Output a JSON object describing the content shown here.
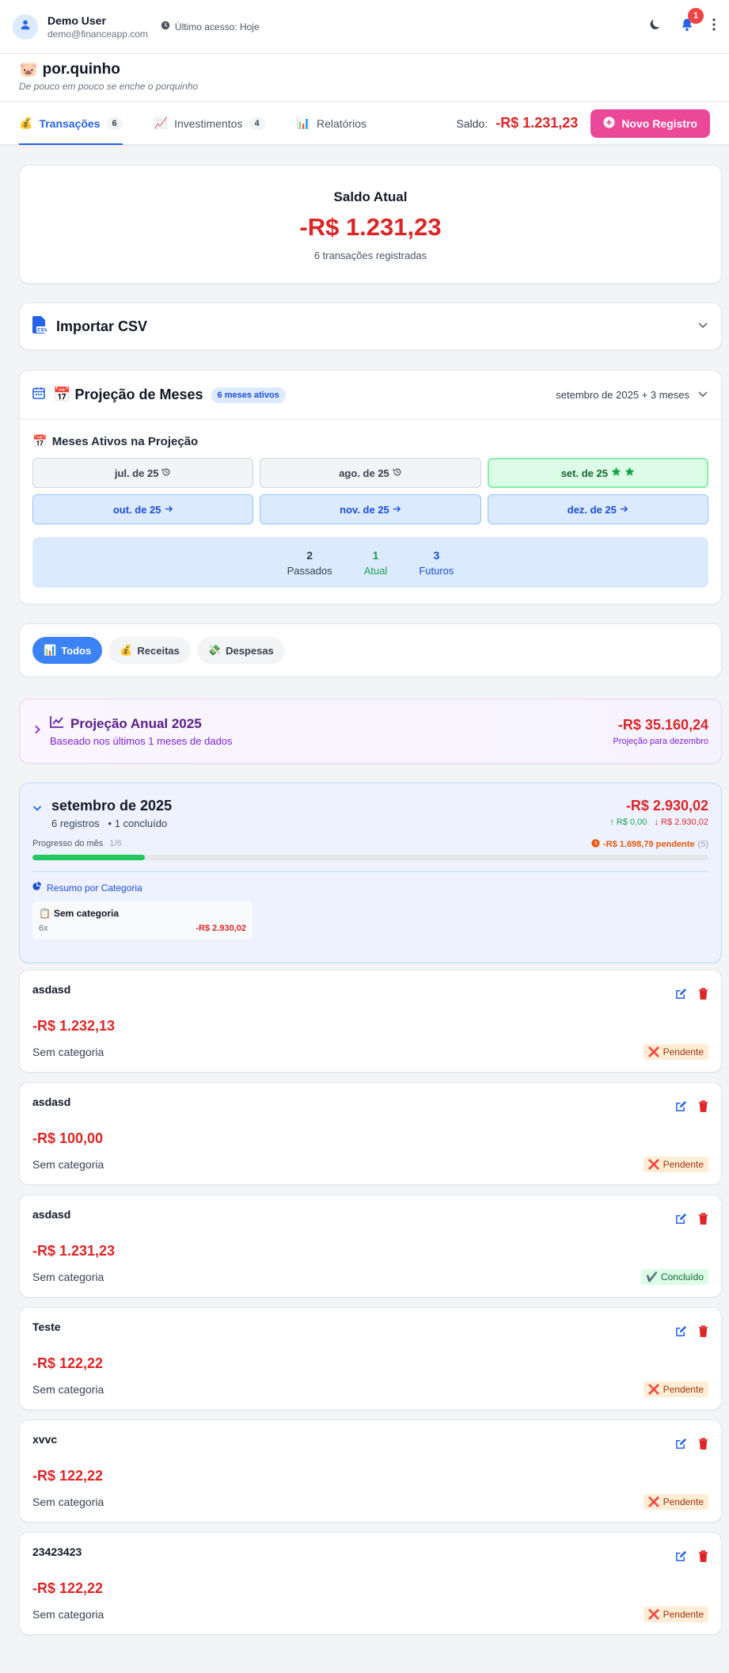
{
  "header": {
    "user_name": "Demo User",
    "user_email": "demo@financeapp.com",
    "last_access": "Último acesso: Hoje",
    "notification_count": "1"
  },
  "brand": {
    "emoji": "🐷",
    "title": "por.quinho",
    "subtitle": "De pouco em pouco se enche o porquinho"
  },
  "tabs": [
    {
      "icon": "💰",
      "label": "Transações",
      "count": "6"
    },
    {
      "icon": "📈",
      "label": "Investimentos",
      "count": "4"
    },
    {
      "icon": "📊",
      "label": "Relatórios",
      "count": ""
    }
  ],
  "toolbar": {
    "saldo_label": "Saldo:",
    "saldo_value": "-R$ 1.231,23",
    "new_button": "Novo Registro"
  },
  "balance": {
    "title": "Saldo Atual",
    "value": "-R$ 1.231,23",
    "subtitle": "6 transações registradas"
  },
  "csv": {
    "label": "Importar CSV"
  },
  "projection": {
    "emoji": "📅",
    "title": "Projeção de Meses",
    "badge": "6 meses ativos",
    "range": "setembro de 2025 + 3 meses",
    "subtitle_emoji": "📅",
    "subtitle": "Meses Ativos na Projeção",
    "months": [
      {
        "label": "jul. de 25",
        "state": "past"
      },
      {
        "label": "ago. de 25",
        "state": "past"
      },
      {
        "label": "set. de 25",
        "state": "current"
      },
      {
        "label": "out. de 25",
        "state": "future"
      },
      {
        "label": "nov. de 25",
        "state": "future"
      },
      {
        "label": "dez. de 25",
        "state": "future"
      }
    ],
    "stats": [
      {
        "n": "2",
        "label": "Passados",
        "color": "#374151"
      },
      {
        "n": "1",
        "label": "Atual",
        "color": "#16a34a"
      },
      {
        "n": "3",
        "label": "Futuros",
        "color": "#1d4ed8"
      }
    ]
  },
  "filters": [
    {
      "icon": "📊",
      "label": "Todos",
      "active": true
    },
    {
      "icon": "💰",
      "label": "Receitas",
      "active": false
    },
    {
      "icon": "💸",
      "label": "Despesas",
      "active": false
    }
  ],
  "annual": {
    "title": "Projeção Anual 2025",
    "subtitle": "Baseado nos últimos 1 meses de dados",
    "value": "-R$ 35.160,24",
    "note": "Projeção para dezembro"
  },
  "month_summary": {
    "title": "setembro de 2025",
    "records": "6 registros",
    "completed": "• 1 concluído",
    "total": "-R$ 2.930,02",
    "income": "↑ R$ 0,00",
    "expense": "↓ R$ 2.930,02",
    "progress_label": "Progresso do mês",
    "progress_count": "1/6",
    "progress_fraction": 0.1667,
    "pending_text": "-R$ 1.698,79 pendente",
    "pending_count": "(5)",
    "category_heading": "Resumo por Categoria",
    "category": {
      "emoji": "📋",
      "name": "Sem categoria",
      "count": "6x",
      "value": "-R$ 2.930,02"
    }
  },
  "transactions": [
    {
      "name": "asdasd",
      "amount": "-R$ 1.232,13",
      "category": "Sem categoria",
      "status": "Pendente",
      "status_icon": "❌",
      "status_type": "pending"
    },
    {
      "name": "asdasd",
      "amount": "-R$ 100,00",
      "category": "Sem categoria",
      "status": "Pendente",
      "status_icon": "❌",
      "status_type": "pending"
    },
    {
      "name": "asdasd",
      "amount": "-R$ 1.231,23",
      "category": "Sem categoria",
      "status": "Concluído",
      "status_icon": "✔️",
      "status_type": "done"
    },
    {
      "name": "Teste",
      "amount": "-R$ 122,22",
      "category": "Sem categoria",
      "status": "Pendente",
      "status_icon": "❌",
      "status_type": "pending"
    },
    {
      "name": "xvvc",
      "amount": "-R$ 122,22",
      "category": "Sem categoria",
      "status": "Pendente",
      "status_icon": "❌",
      "status_type": "pending"
    },
    {
      "name": "23423423",
      "amount": "-R$ 122,22",
      "category": "Sem categoria",
      "status": "Pendente",
      "status_icon": "❌",
      "status_type": "pending"
    }
  ],
  "colors": {
    "accent": "#2563eb",
    "negative": "#dc2626",
    "brand_button": "#ec4899"
  }
}
